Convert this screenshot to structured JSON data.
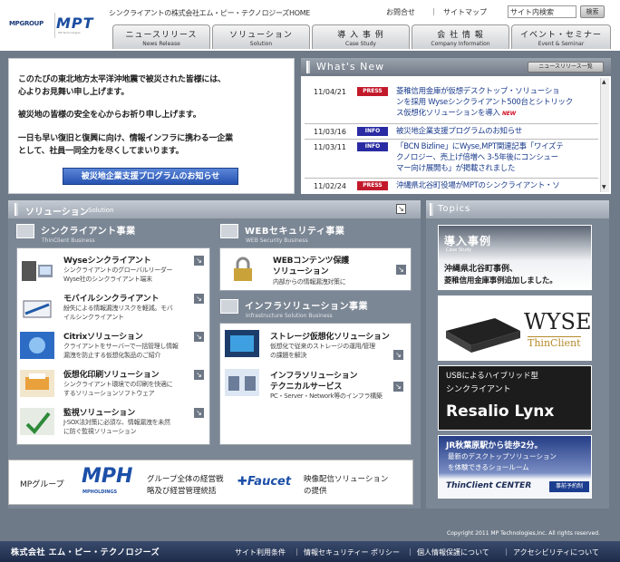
{
  "header": {
    "logo": {
      "group": "MPGROUP",
      "brand": "MPT",
      "brand_sub": "MP Technologies"
    },
    "company_line": "シンクライアントの株式会社エム・ピー・テクノロジーズHOME",
    "links": [
      "お問合せ",
      "サイトマップ"
    ],
    "search": {
      "value": "サイト内検索",
      "button": "検索"
    },
    "nav": [
      {
        "jp": "ニュースリリース",
        "en": "News Release"
      },
      {
        "jp": "ソリューション",
        "en": "Solution"
      },
      {
        "jp": "導 入 事 例",
        "en": "Case Study"
      },
      {
        "jp": "会 社 情 報",
        "en": "Company Information"
      },
      {
        "jp": "イベント・セミナー",
        "en": "Event & Seminar"
      }
    ]
  },
  "quake": {
    "lines": [
      "このたびの東北地方太平洋沖地震で被災された皆様には、",
      "心よりお見舞い申し上げます。",
      "被災地の皆様の安全を心からお祈り申し上げます。",
      "一日も早い復旧と復興に向け、情報インフラに携わる一企業",
      "として、社員一同全力を尽くしてまいります。"
    ],
    "button": "被災地企業支援プログラムのお知らせ"
  },
  "whatsnew": {
    "title": "What's New",
    "list_button": "ニュースリリース一覧",
    "items": [
      {
        "date": "11/04/21",
        "tag": "PRESS",
        "lines": [
          "菱稚信用金庫が仮想デスクトップ・ソリューショ",
          "ンを採用 Wyseシンクライアント500台とシトリック",
          "ス仮想化ソリューションを導入"
        ],
        "badge": "NEW"
      },
      {
        "date": "11/03/16",
        "tag": "INFO",
        "lines": [
          "被災地企業支援プログラムのお知らせ"
        ]
      },
      {
        "date": "11/03/11",
        "tag": "INFO",
        "lines": [
          "「BCN Bizline」にWyse,MPT関連記事「ワイズテ",
          "クノロジー、売上げ倍増へ 3-5年後にコンシュー",
          "マー向け展開も」が掲載されました"
        ]
      },
      {
        "date": "11/02/24",
        "tag": "PRESS",
        "lines": [
          "沖縄県北谷町役場がMPTのシンクライアント・ソ"
        ]
      }
    ]
  },
  "solution": {
    "title": "ソリューション",
    "title_en": "Solution",
    "thin": {
      "title": "シンクライアント事業",
      "en": "ThinClient Business",
      "cards": [
        {
          "t": "Wyseシンクライアント",
          "d": [
            "シンクライアントのグローバルリーダー",
            "Wyse社のシンクライアント端末"
          ]
        },
        {
          "t": "モバイルシンクライアント",
          "d": [
            "紛失による情報漏洩リスクを軽減。モバ",
            "イルシンクライアント"
          ]
        },
        {
          "t": "Citrixソリューション",
          "d": [
            "クライアントをサーバーで一括管理し情報",
            "漏洩を防止する仮想化製品のご紹介"
          ]
        },
        {
          "t": "仮想化印刷ソリューション",
          "d": [
            "シンクライアント環境での印刷を快適に",
            "するソリューションソフトウェア"
          ]
        },
        {
          "t": "監視ソリューション",
          "d": [
            "J-SOX法対策に必須な、情報漏洩を未然",
            "に防ぐ監視ソリューション"
          ]
        }
      ]
    },
    "web": {
      "title": "WEBセキュリティ事業",
      "en": "WEB Security Business",
      "cards": [
        {
          "t": [
            "WEBコンテンツ保護",
            "ソリューション"
          ],
          "d": [
            "内部からの情報漏洩対策に"
          ]
        }
      ]
    },
    "infra": {
      "title": "インフラソリューション事業",
      "en": "Infrastructure Solution Business",
      "cards": [
        {
          "t": [
            "ストレージ仮想化ソリューション"
          ],
          "d": [
            "仮想化で従来のストレージの運用/管理",
            "の課題を解決"
          ]
        },
        {
          "t": [
            "インフラソリューション",
            "テクニカルサービス"
          ],
          "d": [
            "PC・Server・Network等のインフラ構築"
          ]
        }
      ]
    }
  },
  "topics": {
    "title": "Topics",
    "b1": {
      "title": "導入事例",
      "sub": "Case Study",
      "lines": [
        "沖縄県北谷町事例、",
        "菱稚信用金庫事例追加しました。"
      ]
    },
    "b2": {
      "brand": "WYSE",
      "sub": "ThinClient"
    },
    "b3": {
      "line1": "USBによるハイブリッド型",
      "line2": "シンクライアント",
      "brand": "Resalio Lynx"
    },
    "b4": {
      "line1": "JR秋葉原駅から徒歩2分。",
      "line2": "最新のデスクトップソリューション",
      "line3": "を体験できるショールーム",
      "brand": "ThinClient CENTER",
      "button": "事前予約制"
    }
  },
  "bottom": {
    "group_label": "MPグループ",
    "mph": "MPH",
    "mph_sub": "MPHOLDINGS",
    "mph_desc": [
      "グループ全体の経営戦",
      "略及び経営管理統括"
    ],
    "faucet": "Faucet",
    "faucet_desc": [
      "映像配信ソリューション",
      "の提供"
    ]
  },
  "footer": {
    "copyright": "Copyright 2011 MP Technologies,Inc. All rights reserved.",
    "company": "株式会社 エム・ピー・テクノロジーズ",
    "links": [
      "サイト利用条件",
      "情報セキュリティー ポリシー",
      "個人情報保護について",
      "アクセシビリティについて"
    ]
  }
}
